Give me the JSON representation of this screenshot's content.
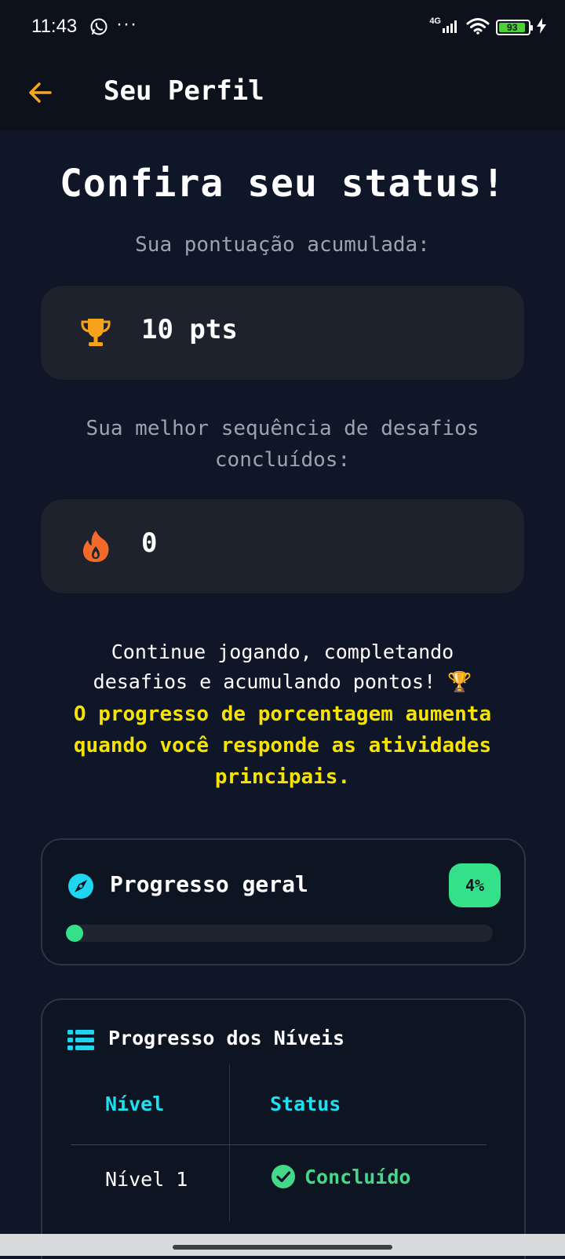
{
  "status_bar": {
    "time": "11:43",
    "dots": "···",
    "network": "4G",
    "battery": "93"
  },
  "appbar": {
    "title": "Seu Perfil",
    "back_icon": "arrow-left-icon",
    "accent": "#f5a623"
  },
  "headline": "Confira seu status!",
  "points": {
    "label": "Sua pontuação acumulada:",
    "value": "10 pts",
    "icon": "trophy-icon"
  },
  "streak": {
    "label_line1": "Sua melhor sequência de desafios",
    "label_line2": "concluídos:",
    "value": "0",
    "icon": "fire-icon"
  },
  "message": {
    "line1": "Continue jogando, completando",
    "line2": "desafios e acumulando pontos! 🏆",
    "highlight_line1": "O progresso de porcentagem aumenta",
    "highlight_line2": "quando você responde as atividades",
    "highlight_line3": "principais."
  },
  "overall_progress": {
    "title": "Progresso geral",
    "percent_label": "4%",
    "percent": 4,
    "color": "#34e08a",
    "icon": "compass-icon"
  },
  "levels": {
    "title": "Progresso dos Níveis",
    "icon": "list-icon",
    "columns": [
      "Nível",
      "Status"
    ],
    "rows": [
      {
        "level": "Nível 1",
        "status": "Concluído",
        "status_icon": "check-circle-icon"
      }
    ],
    "header_color": "#1fe0f0"
  }
}
